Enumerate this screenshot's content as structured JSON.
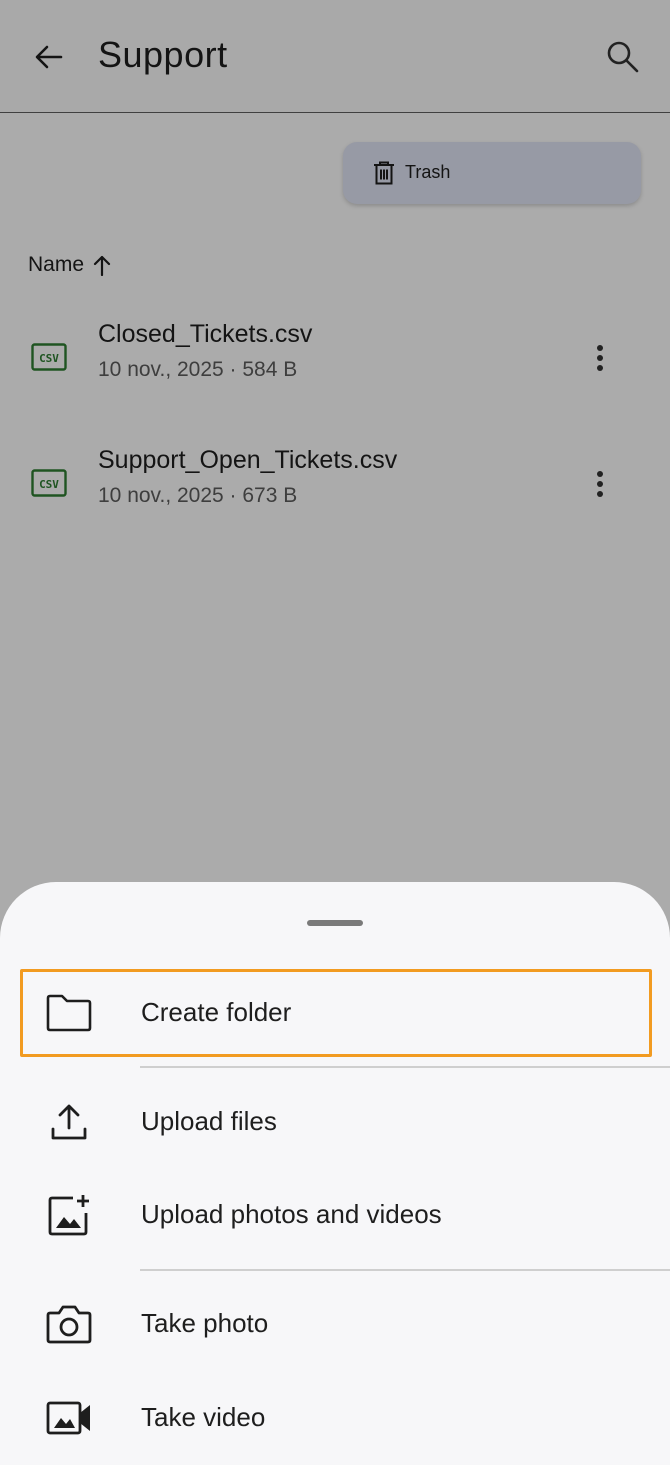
{
  "appbar": {
    "title": "Support"
  },
  "actions": {
    "trash_label": "Trash"
  },
  "sort": {
    "label": "Name"
  },
  "files": [
    {
      "name": "Closed_Tickets.csv",
      "meta": "10 nov., 2025 · 584 B",
      "icon": "csv-file-icon"
    },
    {
      "name": "Support_Open_Tickets.csv",
      "meta": "10 nov., 2025 · 673 B",
      "icon": "csv-file-icon"
    }
  ],
  "sheet": {
    "items": [
      {
        "label": "Create folder",
        "icon": "folder-icon"
      },
      {
        "label": "Upload files",
        "icon": "upload-icon"
      },
      {
        "label": "Upload photos and videos",
        "icon": "add-photo-icon"
      },
      {
        "label": "Take photo",
        "icon": "camera-icon"
      },
      {
        "label": "Take video",
        "icon": "video-camera-icon"
      }
    ]
  },
  "colors": {
    "highlight": "#f29b21",
    "csv_icon": "#2e7d32",
    "chip_bg": "#dfe3f3"
  }
}
